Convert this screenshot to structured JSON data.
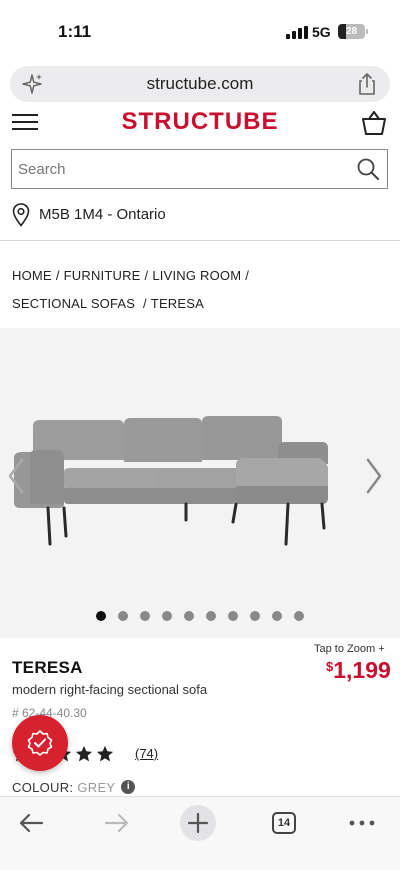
{
  "status": {
    "time": "1:11",
    "network": "5G",
    "battery": "28",
    "battery_level": 0.28
  },
  "browser": {
    "url": "structube.com",
    "tabs_count": "14"
  },
  "header": {
    "logo": "STRUCTUBE"
  },
  "search": {
    "placeholder": "Search"
  },
  "location": {
    "text": "M5B 1M4 - Ontario"
  },
  "breadcrumb": {
    "items": [
      "HOME",
      "FURNITURE",
      "LIVING ROOM",
      "SECTIONAL SOFAS",
      "TERESA"
    ],
    "separator": "/"
  },
  "gallery": {
    "image_count": 10,
    "active_index": 0
  },
  "product": {
    "tap_to_zoom": "Tap to Zoom +",
    "price_symbol": "$",
    "price_value": "1,199",
    "name": "TERESA",
    "description": "modern right-facing sectional sofa",
    "sku": "# 62-44-40.30",
    "rating_stars": 5,
    "reviews": "(74)",
    "colour_label": "COLOUR:",
    "colour_value": "GREY",
    "info_glyph": "i"
  },
  "colors": {
    "brand": "#c8102e",
    "sofa": "#9a9a9a"
  }
}
